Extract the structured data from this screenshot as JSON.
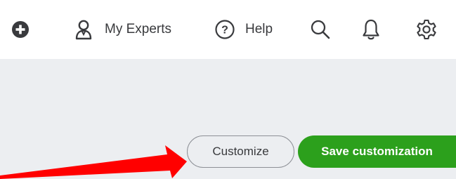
{
  "topbar": {
    "new_icon": "plus-circle-icon",
    "my_experts": {
      "label": "My Experts",
      "icon": "person-icon"
    },
    "help": {
      "label": "Help",
      "icon": "question-circle-icon"
    },
    "search_icon": "search-icon",
    "notifications_icon": "bell-icon",
    "settings_icon": "gear-icon"
  },
  "actions": {
    "customize_label": "Customize",
    "save_label": "Save customization"
  },
  "annotation": {
    "arrow_color": "#ff0000",
    "accent_green": "#2ca01c"
  }
}
